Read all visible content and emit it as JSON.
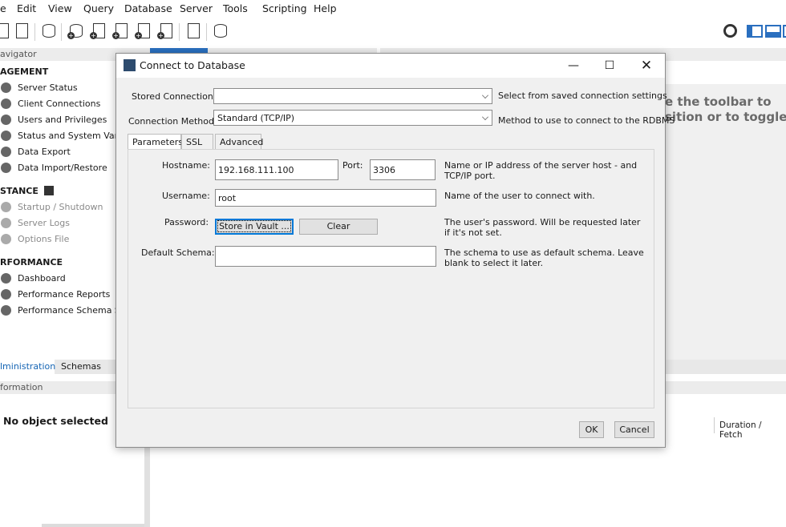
{
  "menubar": [
    "e",
    "Edit",
    "View",
    "Query",
    "Database",
    "Server",
    "Tools",
    "Scripting",
    "Help"
  ],
  "navigator": {
    "header": "avigator",
    "management_title": "AGEMENT",
    "management": [
      "Server Status",
      "Client Connections",
      "Users and Privileges",
      "Status and System Varia",
      "Data Export",
      "Data Import/Restore"
    ],
    "instance_title": "STANCE",
    "instance": [
      "Startup / Shutdown",
      "Server Logs",
      "Options File"
    ],
    "performance_title": "RFORMANCE",
    "performance": [
      "Dashboard",
      "Performance Reports",
      "Performance Schema Se"
    ],
    "tabs": [
      "lministration",
      "Schemas"
    ],
    "info_header": "formation",
    "no_object": "No object selected"
  },
  "background": {
    "hint_line1": "e the toolbar to",
    "hint_line2": "sition or to toggle",
    "duration_col": "Duration / Fetch"
  },
  "dialog": {
    "title": "Connect to Database",
    "stored_connection_label": "Stored Connection:",
    "stored_connection_value": "",
    "stored_connection_hint": "Select from saved connection settings",
    "connection_method_label": "Connection Method:",
    "connection_method_value": "Standard (TCP/IP)",
    "connection_method_hint": "Method to use to connect to the RDBMS",
    "tabs": [
      "Parameters",
      "SSL",
      "Advanced"
    ],
    "hostname_label": "Hostname:",
    "hostname_value": "192.168.111.100",
    "port_label": "Port:",
    "port_value": "3306",
    "hostname_hint": "Name or IP address of the server host - and TCP/IP port.",
    "username_label": "Username:",
    "username_value": "root",
    "username_hint": "Name of the user to connect with.",
    "password_label": "Password:",
    "store_vault_label": "Store in Vault ...",
    "clear_label": "Clear",
    "password_hint": "The user's password. Will be requested later if it's not set.",
    "schema_label": "Default Schema:",
    "schema_value": "",
    "schema_hint": "The schema to use as default schema. Leave blank to select it later.",
    "ok_label": "OK",
    "cancel_label": "Cancel"
  }
}
